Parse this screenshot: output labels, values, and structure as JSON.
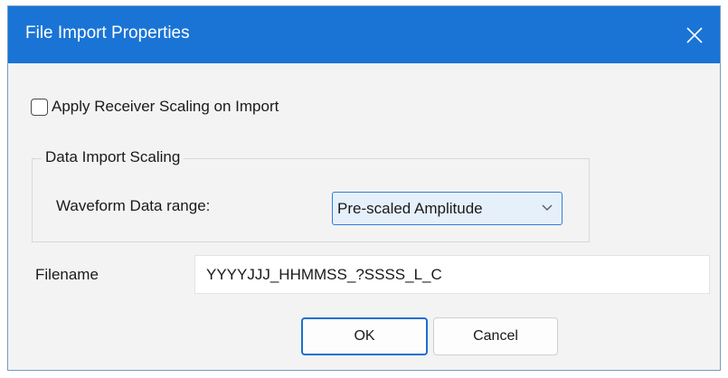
{
  "window": {
    "title": "File Import Properties",
    "close_icon": "close-icon"
  },
  "options": {
    "apply_receiver_scaling_label": "Apply Receiver Scaling on Import",
    "apply_receiver_scaling_checked": false
  },
  "data_import_scaling": {
    "group_label": "Data Import Scaling",
    "waveform_label": "Waveform Data range:",
    "waveform_selected": "Pre-scaled Amplitude"
  },
  "filename": {
    "label": "Filename",
    "value": "YYYYJJJ_HHMMSS_?SSSS_L_C"
  },
  "buttons": {
    "ok": "OK",
    "cancel": "Cancel"
  },
  "colors": {
    "titlebar": "#1a74d6",
    "accent": "#1a6fd1"
  }
}
